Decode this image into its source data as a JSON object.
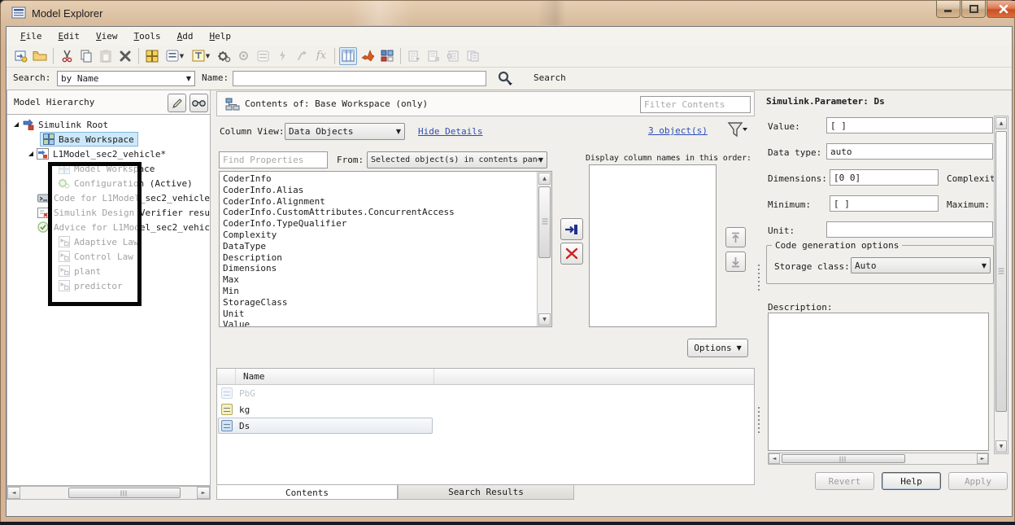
{
  "window": {
    "title": "Model Explorer",
    "controls": {
      "minimize": "minimize",
      "maximize": "maximize",
      "close": "close"
    }
  },
  "menu": {
    "items": [
      {
        "accel": "F",
        "rest": "ile"
      },
      {
        "accel": "E",
        "rest": "dit"
      },
      {
        "accel": "V",
        "rest": "iew"
      },
      {
        "accel": "T",
        "rest": "ools"
      },
      {
        "accel": "A",
        "rest": "dd"
      },
      {
        "accel": "H",
        "rest": "elp"
      }
    ]
  },
  "toolbar": {
    "fx_label": "fx",
    "icons": [
      "new-model-icon",
      "open-folder-icon",
      "cut-icon",
      "copy-icon",
      "paste-icon",
      "delete-icon",
      "base-workspace-icon",
      "add-data-object-icon",
      "add-subsystem-icon",
      "configuration-icon",
      "config-disabled-icon",
      "data-disabled-icon",
      "update-diagram-icon",
      "signal-icon",
      "function-icon",
      "column-view-icon",
      "matlab-icon",
      "color-grid-icon",
      "report-icon-1",
      "report-icon-2",
      "report-icon-3",
      "report-icon-4"
    ]
  },
  "search_bar": {
    "search_label": "Search:",
    "mode_value": "by Name",
    "name_label": "Name:",
    "name_value": "",
    "search_button": "Search"
  },
  "hierarchy": {
    "header": "Model Hierarchy",
    "tree": [
      {
        "label": "Simulink Root"
      },
      {
        "label": "Base Workspace"
      },
      {
        "label": "L1Model_sec2_vehicle*"
      },
      {
        "label": "Model Workspace"
      },
      {
        "label": "Configuration (Active)"
      },
      {
        "label": "Code for L1Model_sec2_vehicle"
      },
      {
        "label": "Simulink Design Verifier resu"
      },
      {
        "label": "Advice for L1Model_sec2_vehic"
      },
      {
        "label": "Adaptive Law"
      },
      {
        "label": "Control Law"
      },
      {
        "label": "plant"
      },
      {
        "label": "predictor"
      }
    ]
  },
  "contents": {
    "header": "Contents of: Base Workspace (only)",
    "filter_placeholder": "Filter Contents",
    "column_view_label": "Column View:",
    "column_view_value": "Data Objects",
    "hide_details_link": "Hide Details",
    "object_count_link": "3 object(s)",
    "find_placeholder": "Find Properties",
    "from_label": "From:",
    "from_value": "Selected object(s) in contents pane",
    "display_label": "Display column names in this order:",
    "options_button": "Options",
    "properties": [
      "CoderInfo",
      "CoderInfo.Alias",
      "CoderInfo.Alignment",
      "CoderInfo.CustomAttributes.ConcurrentAccess",
      "CoderInfo.TypeQualifier",
      "Complexity",
      "DataType",
      "Description",
      "Dimensions",
      "Max",
      "Min",
      "StorageClass",
      "Unit",
      "Value"
    ],
    "table": {
      "name_header": "Name",
      "rows": [
        {
          "name": "PbG",
          "state": "dimmed"
        },
        {
          "name": "kg",
          "state": "normal"
        },
        {
          "name": "Ds",
          "state": "selected"
        }
      ]
    },
    "tabs": [
      {
        "label": "Contents",
        "active": true
      },
      {
        "label": "Search Results",
        "active": false
      }
    ]
  },
  "dialog": {
    "title": "Simulink.Parameter: Ds",
    "value_label": "Value:",
    "value": "[ ]",
    "data_type_label": "Data type:",
    "data_type": "auto",
    "dimensions_label": "Dimensions:",
    "dimensions": "[0 0]",
    "complexity_label": "Complexity:",
    "minimum_label": "Minimum:",
    "minimum": "[ ]",
    "maximum_label": "Maximum:",
    "unit_label": "Unit:",
    "unit": "",
    "group_title": "Code generation options",
    "storage_class_label": "Storage class:",
    "storage_class": "Auto",
    "description_label": "Description:",
    "description": "",
    "buttons": {
      "revert": "Revert",
      "help": "Help",
      "apply": "Apply"
    }
  }
}
